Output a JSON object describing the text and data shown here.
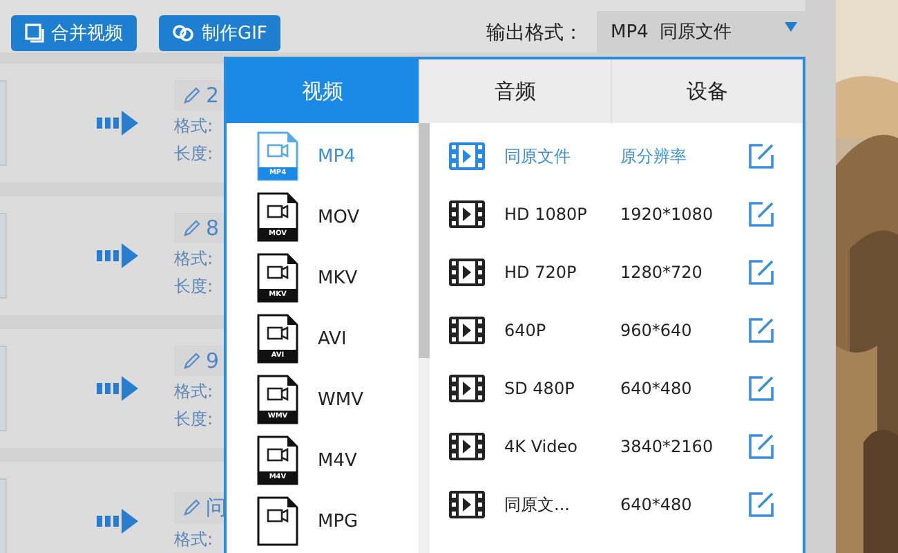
{
  "toolbar": {
    "buttons": [
      {
        "label": "合并视频",
        "kind": "merge"
      },
      {
        "label": "制作GIF",
        "kind": "gif"
      }
    ],
    "output_label": "输出格式：",
    "output_value": "MP4  同原文件"
  },
  "files": [
    {
      "name": "2",
      "format_label": "格式:",
      "length_label": "长度:"
    },
    {
      "name": "8",
      "format_label": "格式:",
      "length_label": "长度:"
    },
    {
      "name": "9",
      "format_label": "格式:",
      "length_label": "长度:"
    },
    {
      "name": "问",
      "format_label": "格式:"
    }
  ],
  "dropdown": {
    "tabs": [
      {
        "label": "视频",
        "selected": true
      },
      {
        "label": "音频",
        "selected": false
      },
      {
        "label": "设备",
        "selected": false
      }
    ],
    "formats": [
      {
        "label": "MP4",
        "badge": "MP4",
        "selected": true
      },
      {
        "label": "MOV",
        "badge": "MOV",
        "selected": false
      },
      {
        "label": "MKV",
        "badge": "MKV",
        "selected": false
      },
      {
        "label": "AVI",
        "badge": "AVI",
        "selected": false
      },
      {
        "label": "WMV",
        "badge": "WMV",
        "selected": false
      },
      {
        "label": "M4V",
        "badge": "M4V",
        "selected": false
      },
      {
        "label": "MPG",
        "selected": false
      }
    ],
    "presets": [
      {
        "name": "同原文件",
        "resolution": "原分辨率",
        "selected": true
      },
      {
        "name": "HD 1080P",
        "resolution": "1920*1080",
        "selected": false
      },
      {
        "name": "HD 720P",
        "resolution": "1280*720",
        "selected": false
      },
      {
        "name": "640P",
        "resolution": "960*640",
        "selected": false
      },
      {
        "name": "SD 480P",
        "resolution": "640*480",
        "selected": false
      },
      {
        "name": "4K Video",
        "resolution": "3840*2160",
        "selected": false
      },
      {
        "name": "同原文...",
        "resolution": "640*480",
        "selected": false
      }
    ]
  }
}
